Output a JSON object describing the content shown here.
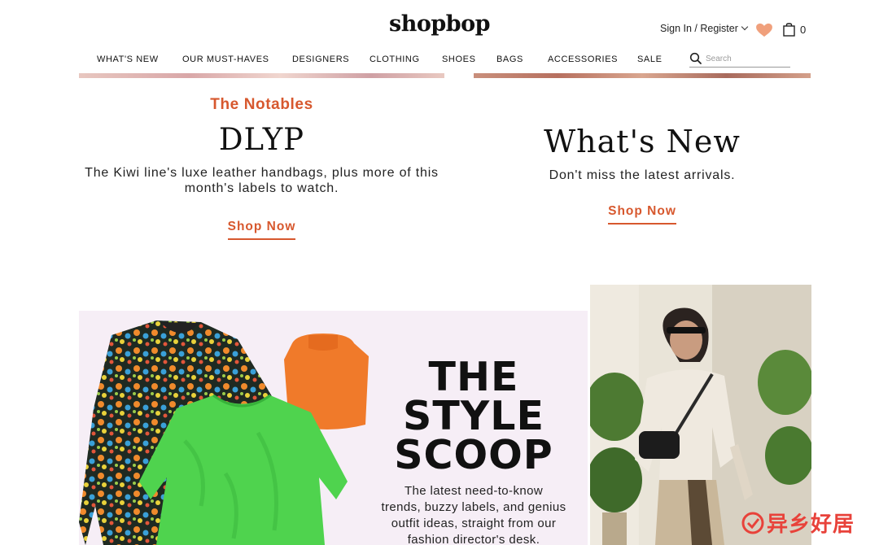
{
  "header": {
    "logo": "shopbop",
    "sign_in": "Sign In / Register",
    "bag_count": "0",
    "search_placeholder": "Search",
    "nav": [
      "WHAT'S NEW",
      "OUR MUST-HAVES",
      "DESIGNERS",
      "CLOTHING",
      "SHOES",
      "BAGS",
      "ACCESSORIES",
      "SALE"
    ]
  },
  "promos": [
    {
      "eyebrow": "The Notables",
      "title": "DLYP",
      "description_line1": "The Kiwi line's luxe leather handbags, plus more of this",
      "description_line2": "month's labels to watch.",
      "cta": "Shop Now"
    },
    {
      "title": "What's New",
      "description": "Don't miss the latest arrivals.",
      "cta": "Shop Now"
    }
  ],
  "style_scoop": {
    "title_lines": [
      "THE",
      "STYLE",
      "SCOOP"
    ],
    "description_lines": [
      "The latest need-to-know",
      "trends, buzzy labels, and genius",
      "outfit ideas, straight from our",
      "fashion director's desk."
    ]
  },
  "watermark": "异乡好居",
  "colors": {
    "accent": "#d7582e",
    "heart": "#f0a07c",
    "scoop_bg": "#f6eef6"
  },
  "icons": [
    "heart-icon",
    "shopping-bag-icon",
    "search-icon",
    "chevron-down-icon"
  ]
}
